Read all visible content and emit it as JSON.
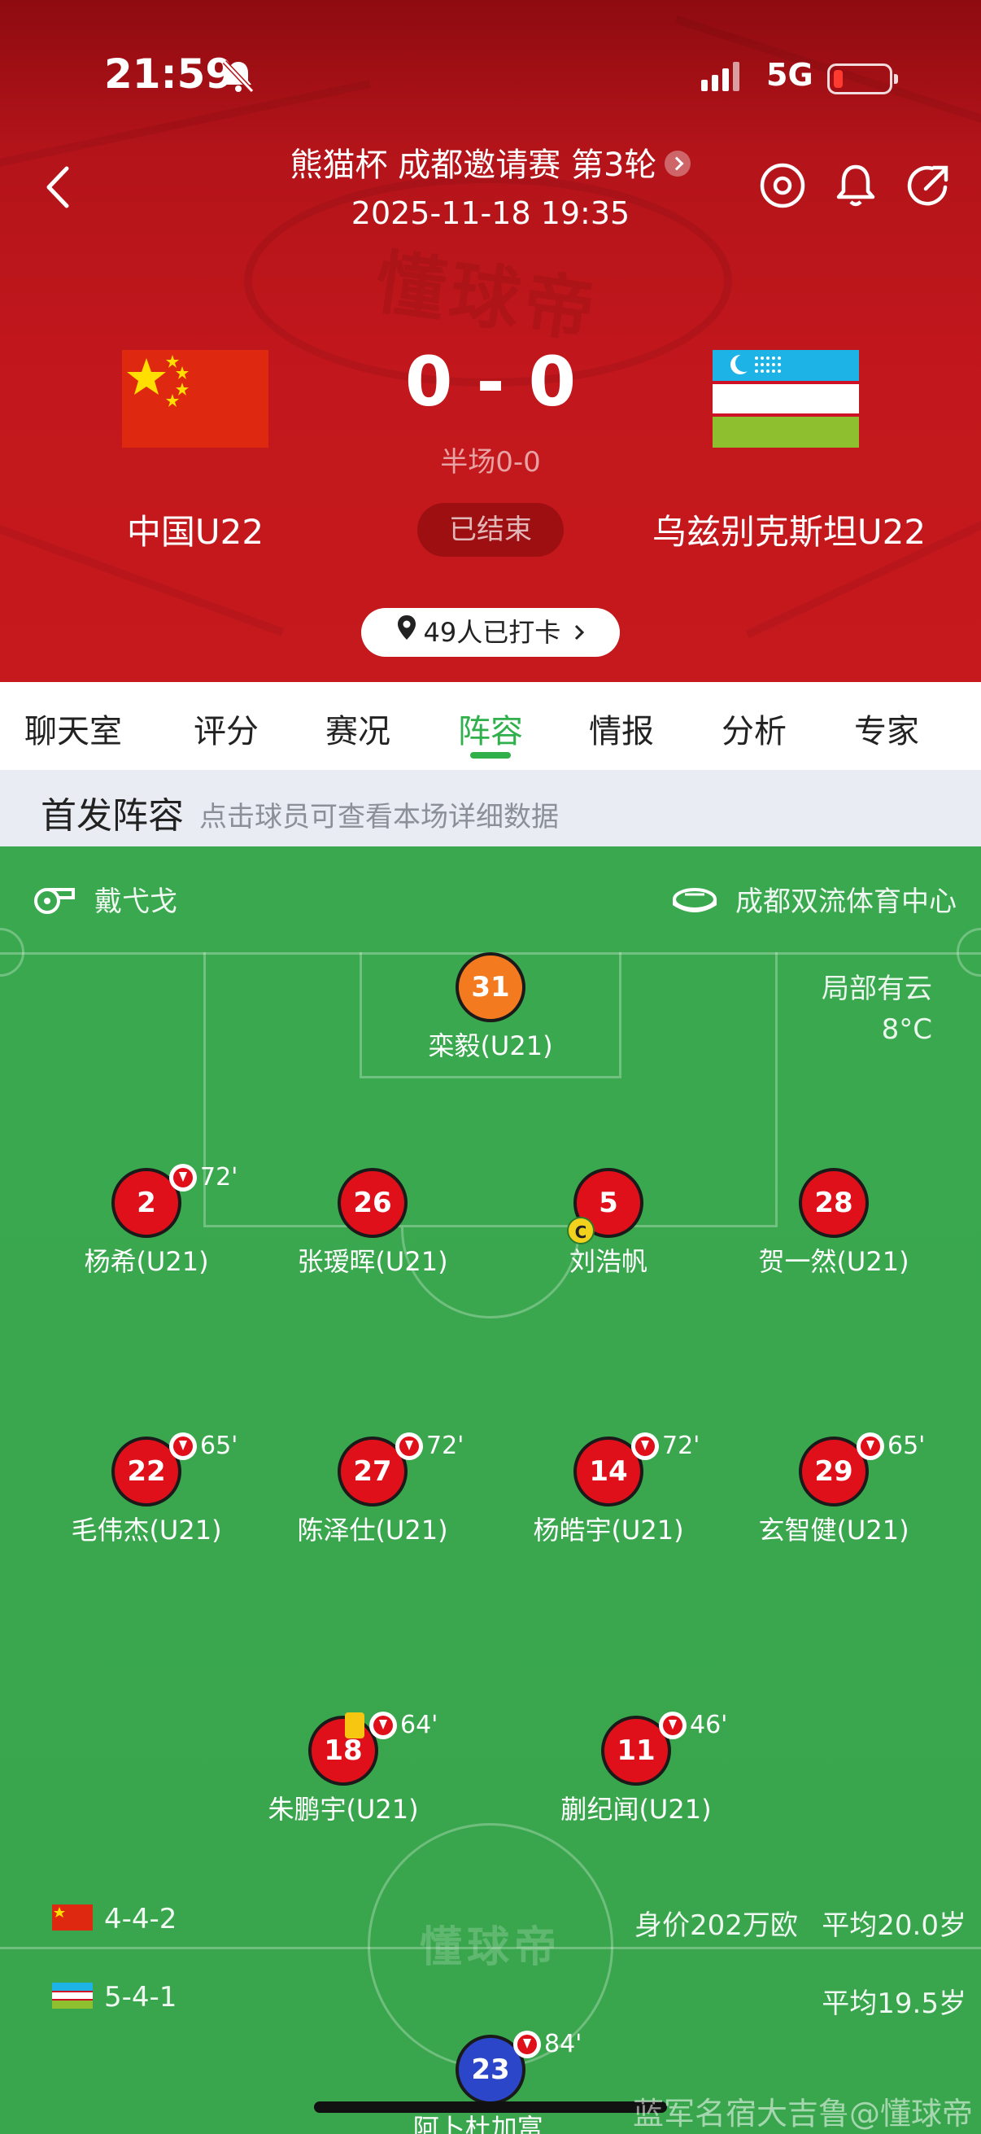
{
  "status_bar": {
    "time": "21:59",
    "network": "5G"
  },
  "header": {
    "competition": "熊猫杯 成都邀请赛 第3轮",
    "datetime": "2025-11-18 19:35",
    "home_team": "中国U22",
    "away_team": "乌兹别克斯坦U22",
    "score": "0 - 0",
    "halftime": "半场0-0",
    "match_status": "已结束",
    "checkin": "49人已打卡",
    "watermark": "懂球帝"
  },
  "tabs": [
    {
      "label": "聊天室",
      "active": false
    },
    {
      "label": "评分",
      "active": false
    },
    {
      "label": "赛况",
      "active": false
    },
    {
      "label": "阵容",
      "active": true
    },
    {
      "label": "情报",
      "active": false
    },
    {
      "label": "分析",
      "active": false
    },
    {
      "label": "专家",
      "active": false
    }
  ],
  "section": {
    "title": "首发阵容",
    "subtitle": "点击球员可查看本场详细数据"
  },
  "pitch_info": {
    "referee": "戴弋戈",
    "venue": "成都双流体育中心",
    "weather": "局部有云",
    "temperature": "8°C",
    "watermark": "懂球帝"
  },
  "home_lineup": {
    "formation": "4-4-2",
    "value": "身价202万欧",
    "avg_age": "平均20.0岁",
    "players": [
      {
        "number": "31",
        "name": "栾毅(U21)",
        "role": "gk"
      },
      {
        "number": "2",
        "name": "杨希(U21)",
        "sub_minute": "72'"
      },
      {
        "number": "26",
        "name": "张瑷晖(U21)"
      },
      {
        "number": "5",
        "name": "刘浩帆",
        "captain": "C"
      },
      {
        "number": "28",
        "name": "贺一然(U21)"
      },
      {
        "number": "22",
        "name": "毛伟杰(U21)",
        "sub_minute": "65'"
      },
      {
        "number": "27",
        "name": "陈泽仕(U21)",
        "sub_minute": "72'"
      },
      {
        "number": "14",
        "name": "杨皓宇(U21)",
        "sub_minute": "72'"
      },
      {
        "number": "29",
        "name": "玄智健(U21)",
        "sub_minute": "65'"
      },
      {
        "number": "18",
        "name": "朱鹏宇(U21)",
        "sub_minute": "64'",
        "yellow_card": true
      },
      {
        "number": "11",
        "name": "蒯纪闻(U21)",
        "sub_minute": "46'"
      }
    ]
  },
  "away_lineup": {
    "formation": "5-4-1",
    "avg_age": "平均19.5岁",
    "players": [
      {
        "number": "23",
        "name": "阿卜杜加富...",
        "sub_minute": "84'"
      }
    ]
  },
  "overlay_watermark": "蓝军名宿大吉鲁@懂球帝",
  "colors": {
    "header_red": "#c5191d",
    "pitch_green": "#3aa84e",
    "accent_green": "#2fb04a",
    "home_player": "#e0101a",
    "goalkeeper": "#f47a20",
    "away_player": "#2b46c9"
  }
}
